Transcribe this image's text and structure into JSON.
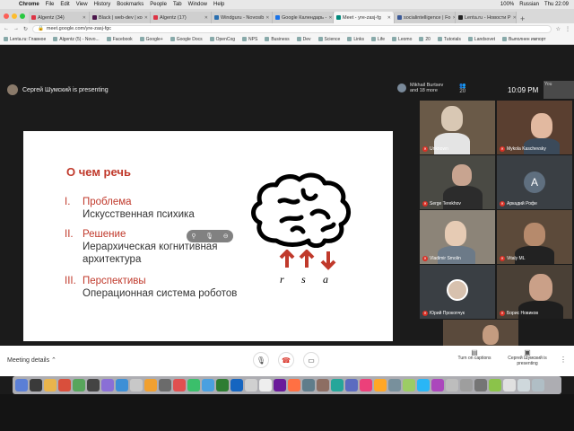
{
  "menubar": {
    "app": "Chrome",
    "items": [
      "File",
      "Edit",
      "View",
      "History",
      "Bookmarks",
      "People",
      "Tab",
      "Window",
      "Help"
    ],
    "battery": "100%",
    "language": "Russian",
    "datetime": "Thu 22:09"
  },
  "tabs": [
    {
      "label": "Algentz (34)",
      "color": "#d34"
    },
    {
      "label": "Black | web-dev | ко",
      "color": "#4a154b"
    },
    {
      "label": "Algentz (17)",
      "color": "#d34"
    },
    {
      "label": "Windguru - Novosib",
      "color": "#2a6fb0"
    },
    {
      "label": "Google Календарь -",
      "color": "#1a73e8"
    },
    {
      "label": "Meet - yre-zasj-fg",
      "color": "#00897b",
      "active": true
    },
    {
      "label": "socialintelligence | Fo",
      "color": "#3b5998"
    },
    {
      "label": "Lenta.ru - Новости Р",
      "color": "#222"
    }
  ],
  "url": "meet.google.com/yre-zasj-fgc",
  "bookmarks": [
    "Lenta.ru: Главное",
    "Algentz (5) - Novo...",
    "Facebook",
    "Google+",
    "Google Docs",
    "OpenCog",
    "NPS",
    "Business",
    "Dev",
    "Science",
    "Links",
    "Life",
    "Leomo",
    "20",
    "Tutorials",
    "Landsovet",
    "Выполнен импорт"
  ],
  "meet": {
    "presenting_text": "Сергей Шумский is presenting",
    "participant_name": "Mikhail Burtsev",
    "participant_more": "and 18 more",
    "people_count": "20",
    "time": "10:09 PM",
    "self_label": "You"
  },
  "slide": {
    "title": "О чем речь",
    "items": [
      {
        "num": "I.",
        "heading": "Проблема",
        "text": "Искусственная психика"
      },
      {
        "num": "II.",
        "heading": "Решение",
        "text": "Иерархическая когнитивная архитектура"
      },
      {
        "num": "III.",
        "heading": "Перспективы",
        "text": "Операционная система роботов"
      }
    ],
    "arrow_labels": [
      "r",
      "s",
      "a"
    ]
  },
  "tiles": [
    {
      "name": "Unknown"
    },
    {
      "name": "Mykola Kaschevsky"
    },
    {
      "name": "Serge Terekhov"
    },
    {
      "name": "Аркадий Рофе",
      "letter": "A"
    },
    {
      "name": "Vladimir Smolin"
    },
    {
      "name": "Vitaly ML"
    },
    {
      "name": "Юрий Прокопчук"
    },
    {
      "name": "Борис Новиков"
    }
  ],
  "bottombar": {
    "meeting_details": "Meeting details",
    "captions_label": "Turn on captions",
    "presenting_label": "Сергей Шумский is presenting"
  },
  "colors": {
    "accent_red": "#c0392b",
    "meet_red": "#d93025"
  }
}
